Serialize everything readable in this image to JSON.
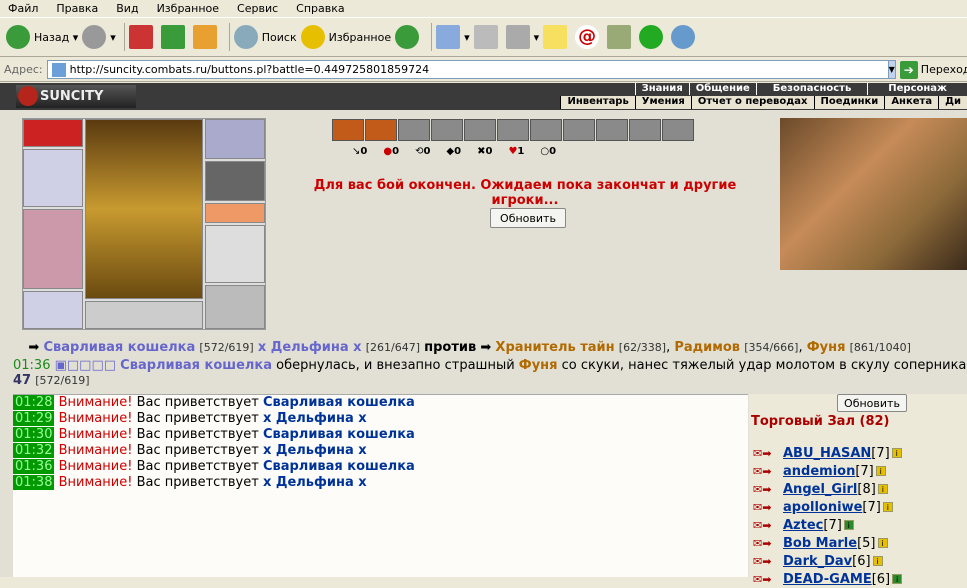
{
  "menu": [
    "Файл",
    "Правка",
    "Вид",
    "Избранное",
    "Сервис",
    "Справка"
  ],
  "toolbar": {
    "back": "Назад",
    "search": "Поиск",
    "favorites": "Избранное"
  },
  "address": {
    "label": "Адрес:",
    "url": "http://suncity.combats.ru/buttons.pl?battle=0.449725801859724",
    "go": "Переход"
  },
  "site": {
    "logo": "SUNCITY",
    "nav_top": [
      "Знания",
      "Общение",
      "Безопасность",
      "Персонаж"
    ],
    "nav_bottom": [
      "Инвентарь",
      "Умения",
      "Отчет о переводах",
      "Поединки",
      "Анкета",
      "Ди"
    ]
  },
  "stats": [
    "0",
    "0",
    "0",
    "0",
    "0",
    "1",
    "0"
  ],
  "message": "Для вас бой окончен. Ожидаем пока закончат и другие игроки...",
  "refresh": "Обновить",
  "battle": {
    "team1_a": "Сварливая кошелка",
    "team1_a_hp": "[572/619]",
    "team1_b": "х Дельфина х",
    "team1_b_hp": "[261/647]",
    "vs": "против",
    "team2_a": "Хранитель тайн",
    "team2_a_hp": "[62/338]",
    "team2_b": "Радимов",
    "team2_b_hp": "[354/666]",
    "team2_c": "Фуня",
    "team2_c_hp": "[861/1040]"
  },
  "log": {
    "time": "01:36",
    "actor": "Сварливая кошелка",
    "text1": " обернулась, и внезапно страшный ",
    "target": "Фуня",
    "text2": " со скуки, нанес тяжелый удар молотом в скулу соперника.",
    "dmg": "47",
    "hp": "[572/619]"
  },
  "chat": [
    {
      "time": "01:28",
      "warn": "Внимание!",
      "text": "Вас приветствует",
      "name": "Сварливая кошелка"
    },
    {
      "time": "01:29",
      "warn": "Внимание!",
      "text": "Вас приветствует",
      "name": "х Дельфина х"
    },
    {
      "time": "01:30",
      "warn": "Внимание!",
      "text": "Вас приветствует",
      "name": "Сварливая кошелка"
    },
    {
      "time": "01:32",
      "warn": "Внимание!",
      "text": "Вас приветствует",
      "name": "х Дельфина х"
    },
    {
      "time": "01:36",
      "warn": "Внимание!",
      "text": "Вас приветствует",
      "name": "Сварливая кошелка"
    },
    {
      "time": "01:38",
      "warn": "Внимание!",
      "text": "Вас приветствует",
      "name": "х Дельфина х"
    }
  ],
  "room": {
    "refresh": "Обновить",
    "title": "Торговый Зал (82)",
    "users": [
      {
        "name": "ABU_HASAN",
        "level": "[7]"
      },
      {
        "name": "andemion",
        "level": "[7]"
      },
      {
        "name": "Angel_Girl",
        "level": "[8]"
      },
      {
        "name": "apolloniwe",
        "level": "[7]"
      },
      {
        "name": "Aztec",
        "level": "[7]"
      },
      {
        "name": "Bob Marle",
        "level": "[5]"
      },
      {
        "name": "Dark_Dav",
        "level": "[6]"
      },
      {
        "name": "DEAD-GAME",
        "level": "[6]"
      }
    ]
  }
}
